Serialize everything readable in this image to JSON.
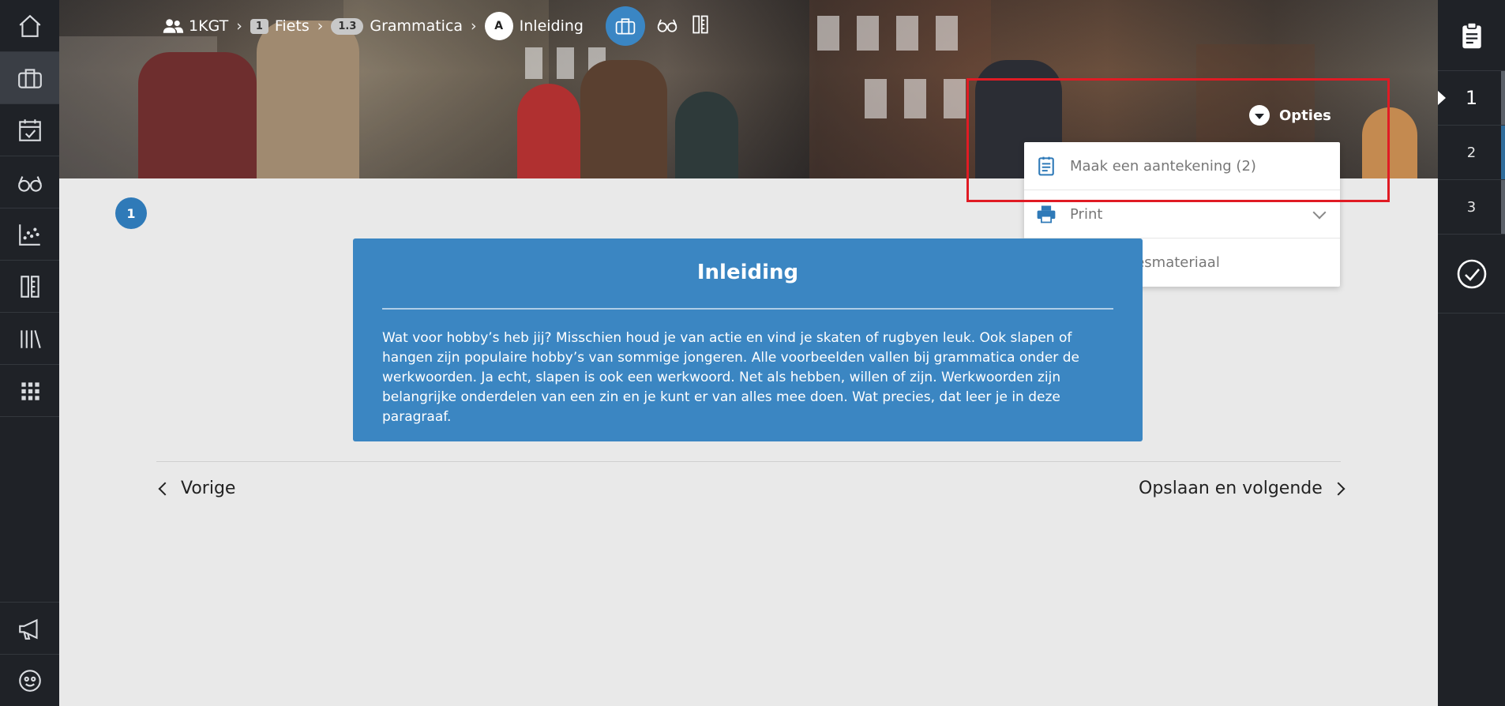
{
  "breadcrumb": {
    "group": "1KGT",
    "chapter_badge": "1",
    "chapter": "Fiets",
    "paragraph_badge": "1.3",
    "paragraph": "Grammatica",
    "section_badge": "A",
    "section": "Inleiding"
  },
  "options": {
    "label": "Opties",
    "items": [
      {
        "label": "Maak een aantekening (2)",
        "icon": "notepad-icon"
      },
      {
        "label": "Print",
        "icon": "printer-icon"
      },
      {
        "label": "Over dit lesmateriaal",
        "icon": "info-icon"
      }
    ]
  },
  "step": {
    "current": "1"
  },
  "card": {
    "title": "Inleiding",
    "body": "Wat voor hobby’s heb jij? Misschien houd je van actie en vind je skaten of rugbyen leuk. Ook slapen of hangen zijn populaire hobby’s van sommige jongeren. Alle voorbeelden vallen bij grammatica onder de werkwoorden. Ja echt, slapen is ook een werkwoord. Net als hebben, willen of zijn. Werkwoorden zijn belangrijke onderdelen van een zin en je kunt er van alles mee doen. Wat precies, dat leer je in deze paragraaf."
  },
  "nav": {
    "prev": "Vorige",
    "next": "Opslaan en volgende"
  },
  "right_sidebar": {
    "steps": [
      "1",
      "2",
      "3"
    ]
  },
  "colors": {
    "accent": "#3b86c2",
    "sidebar": "#1f2227",
    "highlight": "#e01b24"
  }
}
